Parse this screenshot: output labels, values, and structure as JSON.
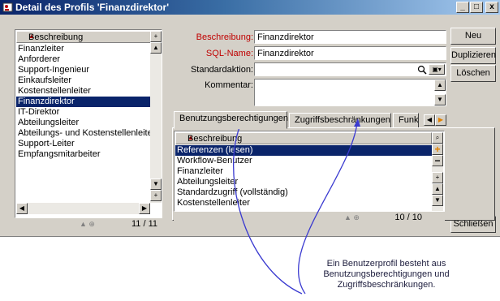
{
  "window": {
    "title": "Detail des Profils 'Finanzdirektor'",
    "minimize_glyph": "_",
    "maximize_glyph": "□",
    "close_glyph": "x"
  },
  "left_list": {
    "header": "Beschreibung",
    "items": [
      "Finanzleiter",
      "Anforderer",
      "Support-Ingenieur",
      "Einkaufsleiter",
      "Kostenstellenleiter",
      "Finanzdirektor",
      "IT-Direktor",
      "Abteilungsleiter",
      "Abteilungs- und Kostenstellenleiter",
      "Support-Leiter",
      "Empfangsmitarbeiter"
    ],
    "selected_index": 5,
    "counter": "11 / 11"
  },
  "form": {
    "beschreibung_label": "Beschreibung:",
    "beschreibung_value": "Finanzdirektor",
    "sqlname_label": "SQL-Name:",
    "sqlname_value": "Finanzdirektor",
    "standardaktion_label": "Standardaktion:",
    "standardaktion_value": "",
    "kommentar_label": "Kommentar:",
    "kommentar_value": ""
  },
  "buttons": {
    "neu": "Neu",
    "duplizieren": "Duplizieren",
    "loeschen": "Löschen",
    "schliessen": "Schließen"
  },
  "tabs": [
    "Benutzungsberechtigungen",
    "Zugriffsbeschränkungen",
    "Funk"
  ],
  "active_tab": 0,
  "tab_list": {
    "header": "Beschreibung",
    "items": [
      "Referenzen (lesen)",
      "Workflow-Benutzer",
      "Finanzleiter",
      "Abteilungsleiter",
      "Standardzugriff (vollständig)",
      "Kostenstellenleiter"
    ],
    "selected_index": 0,
    "counter": "10 / 10"
  },
  "annotation": {
    "lines": [
      "Ein Benutzerprofil besteht aus",
      "Benutzungsberechtigungen und",
      "Zugriffsbeschränkungen."
    ]
  },
  "colors": {
    "title_start": "#0a246a",
    "title_end": "#a6caf0",
    "selection": "#0a246a",
    "required_label": "#c00000",
    "callout_line": "#3a3ad0",
    "add_icon": "#e08000"
  },
  "icons": {
    "title": "profile-icon",
    "sort": "sort-triangle-icon",
    "search": "magnifier-icon",
    "add": "plus-icon",
    "remove": "minus-icon",
    "tab_scroll_left": "arrow-left-icon",
    "tab_scroll_right": "arrow-right-icon"
  }
}
